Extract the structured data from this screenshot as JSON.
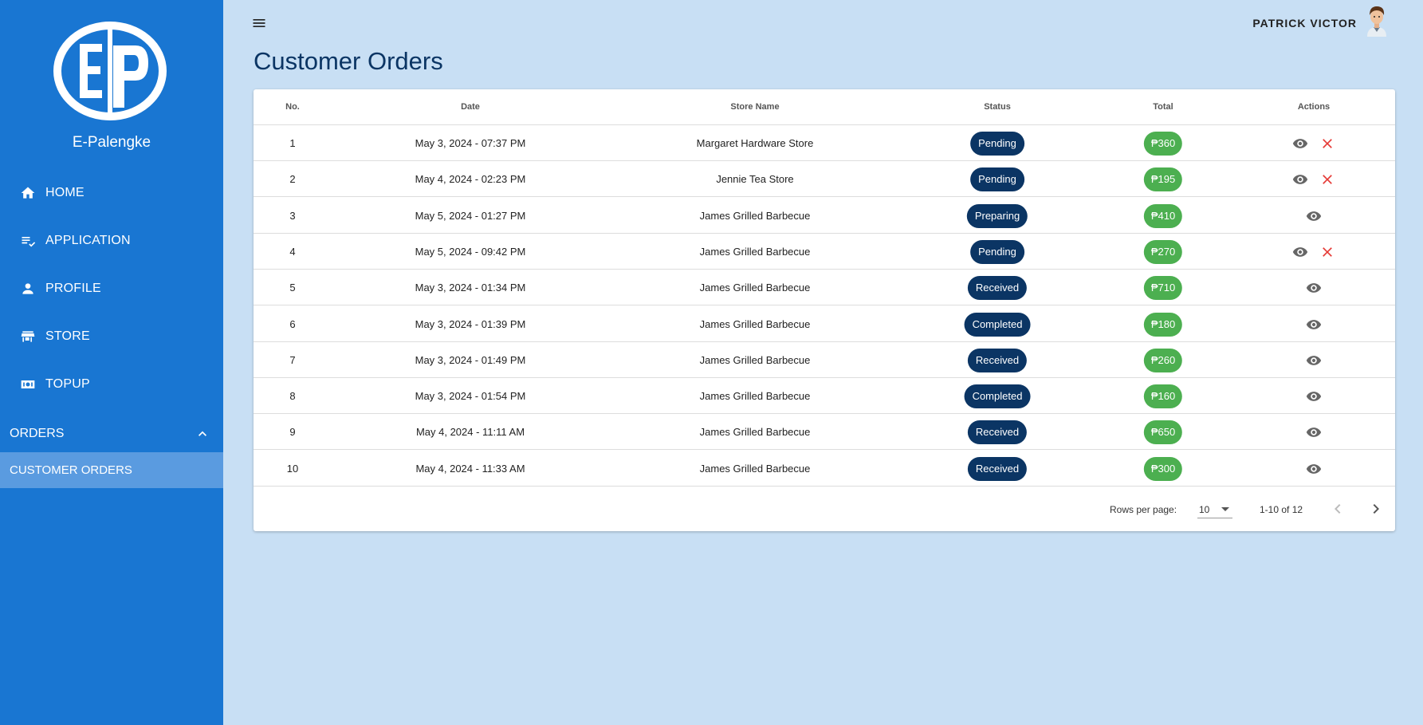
{
  "sidebar": {
    "brand": "E-Palengke",
    "items": [
      {
        "label": "HOME",
        "icon": "home-icon"
      },
      {
        "label": "APPLICATION",
        "icon": "playlist-check-icon"
      },
      {
        "label": "PROFILE",
        "icon": "person-icon"
      },
      {
        "label": "STORE",
        "icon": "store-icon"
      },
      {
        "label": "TOPUP",
        "icon": "money-icon"
      }
    ],
    "section": {
      "label": "ORDERS",
      "icon": "chevron-up-icon"
    },
    "active_sub": "CUSTOMER ORDERS"
  },
  "header": {
    "user_name": "PATRICK VICTOR",
    "title": "Customer Orders"
  },
  "table": {
    "columns": [
      "No.",
      "Date",
      "Store Name",
      "Status",
      "Total",
      "Actions"
    ],
    "rows": [
      {
        "no": "1",
        "date": "May 3, 2024 - 07:37 PM",
        "store": "Margaret Hardware Store",
        "status": "Pending",
        "total": "₱360",
        "cancel": true
      },
      {
        "no": "2",
        "date": "May 4, 2024 - 02:23 PM",
        "store": "Jennie Tea Store",
        "status": "Pending",
        "total": "₱195",
        "cancel": true
      },
      {
        "no": "3",
        "date": "May 5, 2024 - 01:27 PM",
        "store": "James Grilled Barbecue",
        "status": "Preparing",
        "total": "₱410",
        "cancel": false
      },
      {
        "no": "4",
        "date": "May 5, 2024 - 09:42 PM",
        "store": "James Grilled Barbecue",
        "status": "Pending",
        "total": "₱270",
        "cancel": true
      },
      {
        "no": "5",
        "date": "May 3, 2024 - 01:34 PM",
        "store": "James Grilled Barbecue",
        "status": "Received",
        "total": "₱710",
        "cancel": false
      },
      {
        "no": "6",
        "date": "May 3, 2024 - 01:39 PM",
        "store": "James Grilled Barbecue",
        "status": "Completed",
        "total": "₱180",
        "cancel": false
      },
      {
        "no": "7",
        "date": "May 3, 2024 - 01:49 PM",
        "store": "James Grilled Barbecue",
        "status": "Received",
        "total": "₱260",
        "cancel": false
      },
      {
        "no": "8",
        "date": "May 3, 2024 - 01:54 PM",
        "store": "James Grilled Barbecue",
        "status": "Completed",
        "total": "₱160",
        "cancel": false
      },
      {
        "no": "9",
        "date": "May 4, 2024 - 11:11 AM",
        "store": "James Grilled Barbecue",
        "status": "Received",
        "total": "₱650",
        "cancel": false
      },
      {
        "no": "10",
        "date": "May 4, 2024 - 11:33 AM",
        "store": "James Grilled Barbecue",
        "status": "Received",
        "total": "₱300",
        "cancel": false
      }
    ]
  },
  "pagination": {
    "rows_per_page_label": "Rows per page:",
    "rows_per_page": "10",
    "range": "1-10 of 12"
  },
  "colors": {
    "sidebar": "#1976d2",
    "background": "#c8dff4",
    "status_badge": "#0b3564",
    "total_badge": "#4caf50",
    "cancel": "#e53935"
  }
}
